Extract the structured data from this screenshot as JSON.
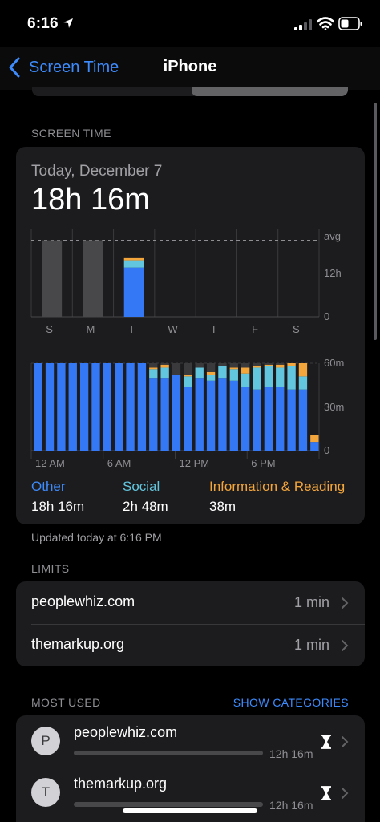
{
  "status_bar": {
    "time": "6:16"
  },
  "nav": {
    "back_label": "Screen Time",
    "title": "iPhone"
  },
  "screen_time": {
    "section_header": "SCREEN TIME",
    "date": "Today, December 7",
    "total": "18h 16m",
    "categories": [
      {
        "name": "Other",
        "value": "18h 16m",
        "color": "#3478f6"
      },
      {
        "name": "Social",
        "value": "2h 48m",
        "color": "#62c6df"
      },
      {
        "name": "Information & Reading",
        "value": "38m",
        "color": "#f3a63c"
      }
    ],
    "updated": "Updated today at 6:16 PM"
  },
  "chart_data": [
    {
      "type": "bar",
      "categories": [
        "S",
        "M",
        "T",
        "W",
        "T",
        "F",
        "S"
      ],
      "series": [
        {
          "name": "Other",
          "values": [
            null,
            null,
            13.5,
            null,
            null,
            null,
            null
          ]
        },
        {
          "name": "Social",
          "values": [
            null,
            null,
            2.0,
            null,
            null,
            null,
            null
          ]
        },
        {
          "name": "Information & Reading",
          "values": [
            null,
            null,
            0.6,
            null,
            null,
            null,
            null
          ]
        }
      ],
      "past_totals": [
        21,
        21,
        null,
        null,
        null,
        null,
        null
      ],
      "y_ticks": [
        "0",
        "12h",
        "avg"
      ],
      "ylim": [
        0,
        24
      ],
      "avg_hours": 21,
      "highlight": "T"
    },
    {
      "type": "bar",
      "x_tick_labels": [
        "12 AM",
        "6 AM",
        "12 PM",
        "6 PM"
      ],
      "y_ticks": [
        "0",
        "30m",
        "60m"
      ],
      "ylim": [
        0,
        60
      ],
      "series": [
        {
          "name": "Other",
          "values": [
            60,
            60,
            60,
            60,
            60,
            60,
            60,
            60,
            60,
            60,
            50,
            50,
            52,
            44,
            50,
            48,
            50,
            48,
            44,
            42,
            44,
            44,
            42,
            42,
            6
          ]
        },
        {
          "name": "Social",
          "values": [
            0,
            0,
            0,
            0,
            0,
            0,
            0,
            0,
            0,
            0,
            6,
            7,
            0,
            7,
            7,
            4,
            8,
            8,
            9,
            15,
            14,
            13,
            16,
            9,
            0
          ]
        },
        {
          "name": "Information & Reading",
          "values": [
            0,
            0,
            0,
            0,
            0,
            0,
            0,
            0,
            0,
            0,
            1,
            2,
            0,
            1,
            0,
            2,
            0,
            1,
            4,
            1,
            1,
            2,
            2,
            9,
            5
          ]
        },
        {
          "name": "Unspecified",
          "values": [
            0,
            0,
            0,
            0,
            0,
            0,
            0,
            0,
            0,
            0,
            3,
            1,
            8,
            8,
            3,
            6,
            2,
            3,
            3,
            2,
            1,
            1,
            0,
            0,
            0
          ]
        }
      ]
    }
  ],
  "limits": {
    "section_header": "LIMITS",
    "items": [
      {
        "label": "peoplewhiz.com",
        "value": "1 min"
      },
      {
        "label": "themarkup.org",
        "value": "1 min"
      }
    ]
  },
  "most_used": {
    "section_header": "MOST USED",
    "show_categories": "SHOW CATEGORIES",
    "items": [
      {
        "initial": "P",
        "name": "peoplewhiz.com",
        "time": "12h 16m"
      },
      {
        "initial": "T",
        "name": "themarkup.org",
        "time": "12h 16m"
      }
    ]
  },
  "colors": {
    "accent": "#3d8bfd",
    "card": "#1c1c1e",
    "other": "#3478f6",
    "social": "#62c6df",
    "info": "#f3a63c",
    "past": "#48484a"
  }
}
